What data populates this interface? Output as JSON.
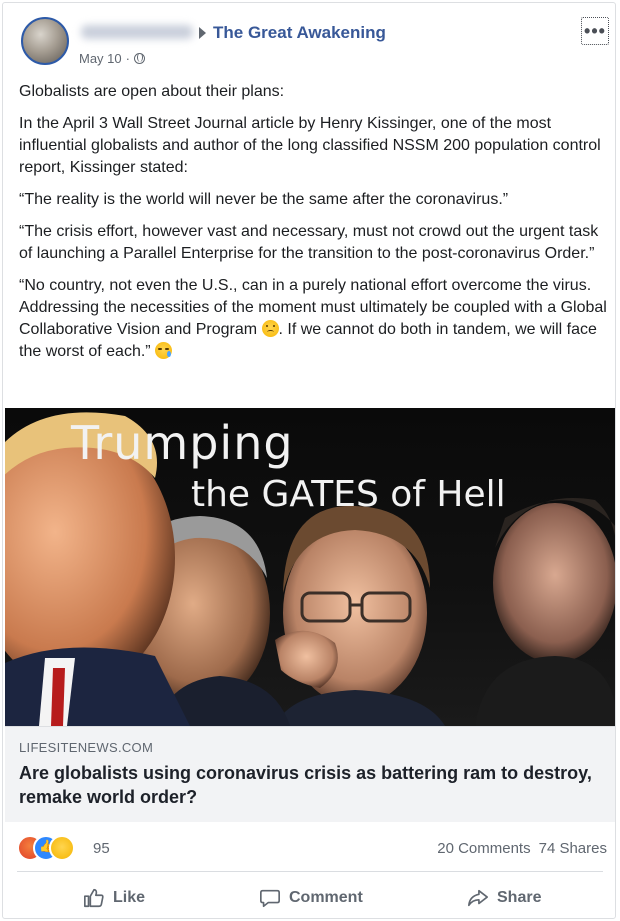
{
  "post": {
    "group_name": "The Great Awakening",
    "date": "May 10",
    "paragraphs": [
      "Globalists are open about their plans:",
      "In the April 3 Wall Street Journal article by Henry Kissinger, one of the most influential globalists and author of the long classified NSSM 200 population control report, Kissinger stated:",
      "“The reality is the world will never be the same after the coronavirus.”",
      "“The crisis effort, however vast and necessary, must not crowd out the urgent task of launching a Parallel Enterprise for the transition to the post-coronavirus Order.”"
    ],
    "last_paragraph_part1": "“No country, not even the U.S., can in a purely national effort overcome the virus. Addressing the necessities of the moment must ultimately be coupled with a Global Collaborative Vision and Program",
    "last_paragraph_part2": ". If we cannot do both in tandem, we will face the worst of each.”",
    "emoji_1": "sad-face-emoji",
    "emoji_2": "crying-face-emoji"
  },
  "image": {
    "title_line1": "Trumping",
    "title_line2": "the GATES  of Hell"
  },
  "link": {
    "domain": "LIFESITENEWS.COM",
    "title": "Are globalists using coronavirus crisis as battering ram to destroy, remake world order?"
  },
  "stats": {
    "reaction_count": "95",
    "comments": "20 Comments",
    "shares": "74 Shares"
  },
  "actions": {
    "like": "Like",
    "comment": "Comment",
    "share": "Share"
  },
  "colors": {
    "group_link": "#385898",
    "like_blue": "#2d88ff",
    "angry": "#e0412a"
  }
}
